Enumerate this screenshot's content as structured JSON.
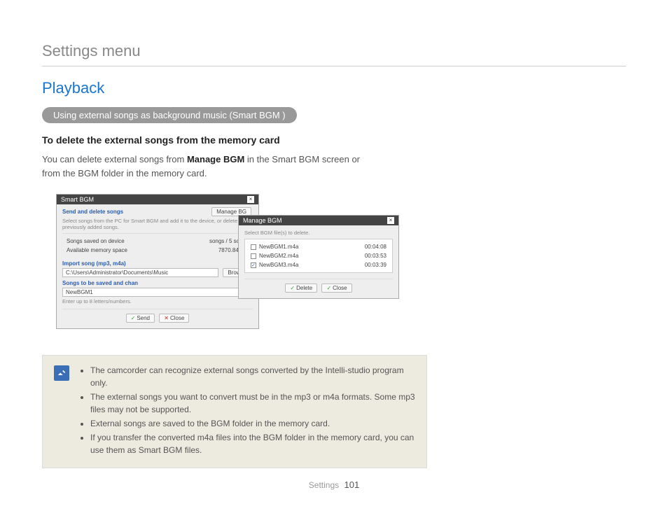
{
  "header": "Settings menu",
  "section": "Playback",
  "pill": "Using external songs as background music (Smart BGM   )",
  "subheading": "To delete the external songs from the memory card",
  "body_prefix": "You can delete external songs from ",
  "body_bold": "Manage BGM",
  "body_suffix": " in the Smart BGM screen or from the BGM folder in the memory card.",
  "dialog1": {
    "title": "Smart BGM",
    "section1": "Send and delete songs",
    "manage_btn": "Manage BG",
    "desc": "Select songs from the PC for Smart BGM and add it to the device, or delete previously added songs.",
    "row1_label": "Songs saved on device",
    "row1_val": "songs / 5 songs",
    "row2_label": "Available memory space",
    "row2_val": "7870.84 MB",
    "import_label": "Import song (mp3, m4a)",
    "path": "C:\\Users\\Administrator\\Documents\\Music",
    "browse": "Browse",
    "save_label": "Songs to be saved and chan",
    "newname": "NewBGM1",
    "hint": "Enter up to 8 letters/numbers.",
    "send": "Send",
    "close": "Close"
  },
  "dialog2": {
    "title": "Manage BGM",
    "desc": "Select BGM file(s) to delete.",
    "files": [
      {
        "name": "NewBGM1.m4a",
        "dur": "00:04:08"
      },
      {
        "name": "NewBGM2.m4a",
        "dur": "00:03:53"
      },
      {
        "name": "NewBGM3.m4a",
        "dur": "00:03:39"
      }
    ],
    "delete": "Delete",
    "close": "Close"
  },
  "notes": [
    "The camcorder can recognize external songs converted by the Intelli-studio program only.",
    "The external songs you want to convert must be in the mp3 or m4a formats. Some mp3 files may not be supported.",
    "External songs are saved to the BGM folder in the memory card.",
    "If you transfer the converted m4a files into the BGM folder in the memory card, you can use them as Smart BGM files."
  ],
  "footer_label": "Settings",
  "footer_page": "101"
}
